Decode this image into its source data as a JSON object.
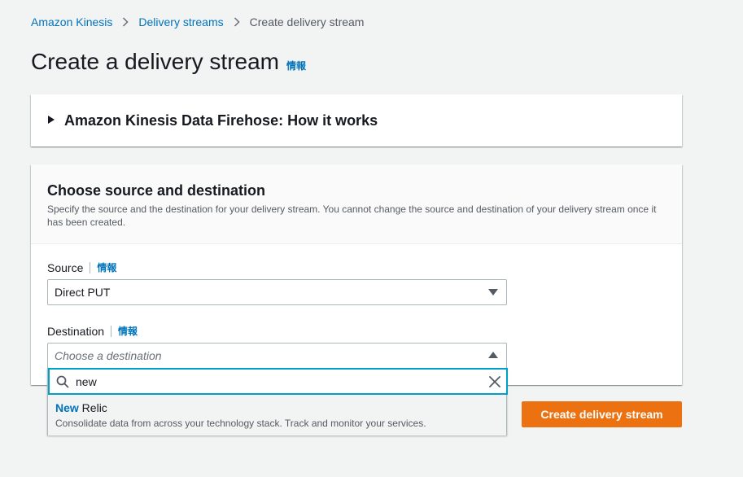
{
  "breadcrumb": {
    "items": [
      {
        "label": "Amazon Kinesis"
      },
      {
        "label": "Delivery streams"
      }
    ],
    "current": "Create delivery stream"
  },
  "page": {
    "title": "Create a delivery stream",
    "info_label": "情報"
  },
  "how_it_works": {
    "title": "Amazon Kinesis Data Firehose: How it works",
    "expanded": false
  },
  "source_destination": {
    "title": "Choose source and destination",
    "description": "Specify the source and the destination for your delivery stream. You cannot change the source and destination of your delivery stream once it has been created.",
    "source": {
      "label": "Source",
      "info_label": "情報",
      "value": "Direct PUT"
    },
    "destination": {
      "label": "Destination",
      "info_label": "情報",
      "placeholder": "Choose a destination",
      "expanded": true,
      "filter_value": "new",
      "options": [
        {
          "match": "New",
          "rest": " Relic",
          "description": "Consolidate data from across your technology stack. Track and monitor your services."
        }
      ]
    }
  },
  "actions": {
    "create_label": "Create delivery stream"
  },
  "colors": {
    "link": "#0073bb",
    "primary": "#ec7211",
    "focus": "#00a1c9",
    "background": "#f2f3f3"
  },
  "icons": {
    "breadcrumb_separator": "chevron-right-icon",
    "expand": "caret-right-icon",
    "select": "caret-down-icon",
    "select_open": "caret-up-icon",
    "search": "search-icon",
    "clear": "close-icon"
  }
}
